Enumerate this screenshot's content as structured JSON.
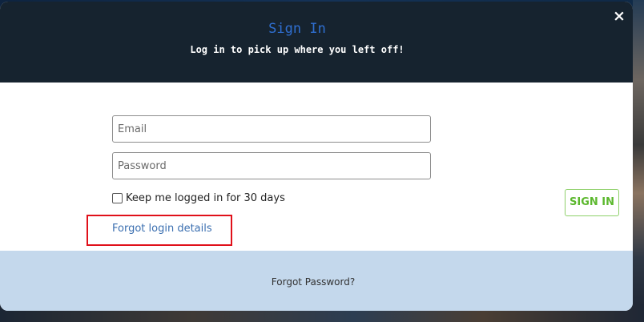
{
  "modal": {
    "title": "Sign In",
    "subtitle": "Log in to pick up where you left off!",
    "close_icon": "×"
  },
  "form": {
    "email_placeholder": "Email",
    "email_value": "",
    "password_placeholder": "Password",
    "password_value": "",
    "remember_label": "Keep me logged in for 30 days",
    "remember_checked": false,
    "forgot_link": "Forgot login details",
    "signin_label": "SIGN IN"
  },
  "footer": {
    "text": "Forgot Password?"
  },
  "colors": {
    "header_bg": "#16232f",
    "title": "#2f6fd1",
    "signin_green": "#5cb82e",
    "footer_bg": "#c4d8ec",
    "highlight_red": "#e0101a",
    "link_blue": "#3b6fb0"
  }
}
